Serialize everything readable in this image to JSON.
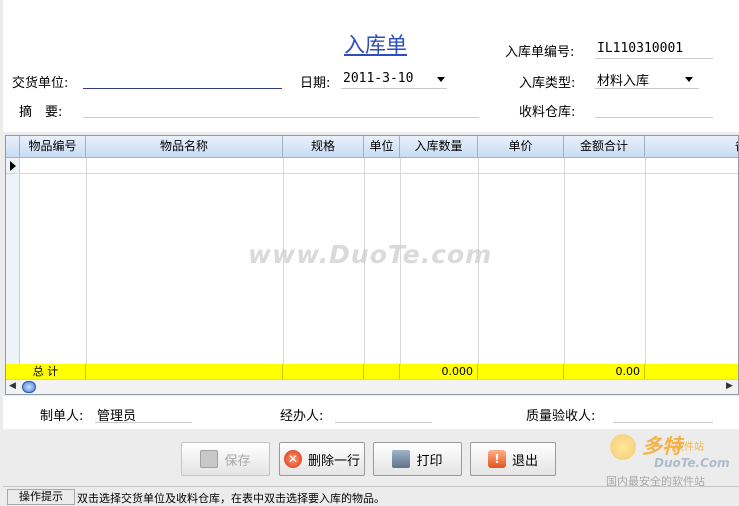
{
  "header": {
    "title": "入库单",
    "order_no_label": "入库单编号:",
    "order_no": "IL110310001",
    "supplier_label": "交货单位:",
    "supplier": "",
    "date_label": "日期:",
    "date": "2011-3-10",
    "type_label": "入库类型:",
    "type": "材料入库",
    "summary_label": "摘　要:",
    "summary": "",
    "warehouse_label": "收料仓库:",
    "warehouse": ""
  },
  "grid": {
    "columns": [
      "物品编号",
      "物品名称",
      "规格",
      "单位",
      "入库数量",
      "单价",
      "金额合计",
      "备"
    ],
    "total_label": "总 计",
    "total_qty": "0.000",
    "total_amount": "0.00"
  },
  "watermark": "www.DuoTe.com",
  "footer": {
    "maker_label": "制单人:",
    "maker": "管理员",
    "handler_label": "经办人:",
    "handler": "",
    "inspector_label": "质量验收人:",
    "inspector": ""
  },
  "buttons": {
    "save": "保存",
    "delete_row": "删除一行",
    "print": "打印",
    "exit": "退出"
  },
  "status": {
    "label": "操作提示",
    "text": "双击选择交货单位及收料仓库，在表中双击选择要入库的物品。"
  },
  "logo": {
    "brand": "多特",
    "brand_suffix": "软件站",
    "site": "DuoTe.Com",
    "slogan": "国内最安全的软件站"
  }
}
